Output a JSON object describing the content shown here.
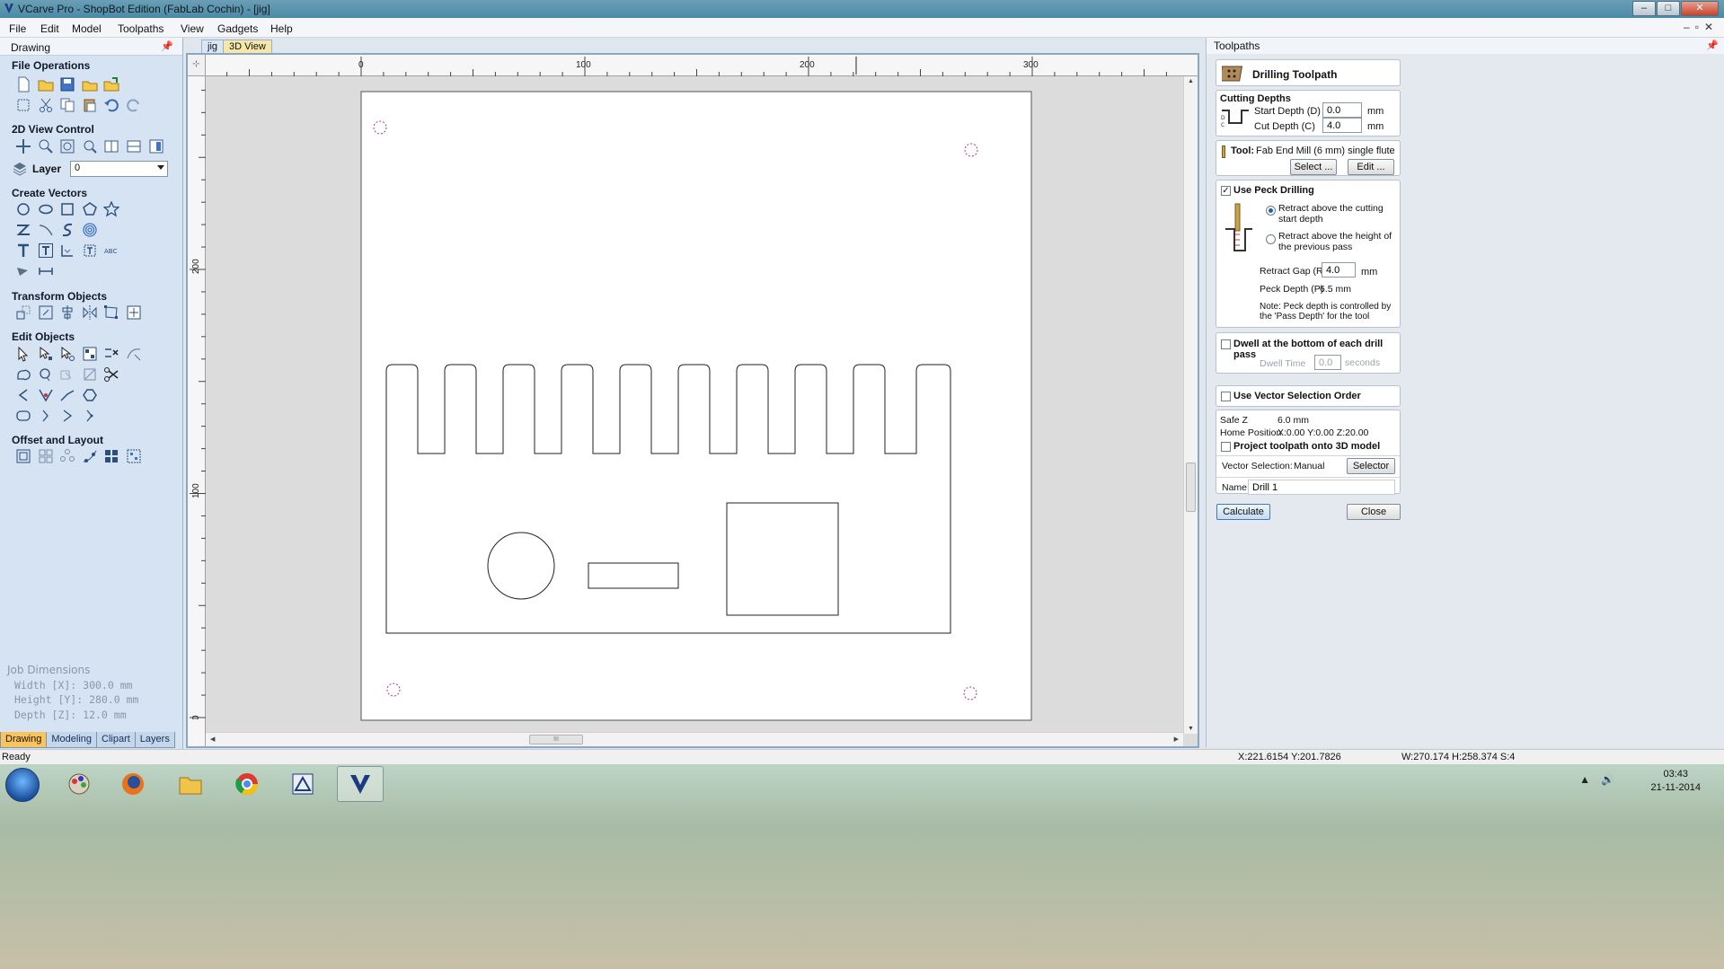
{
  "window": {
    "title": "VCarve Pro - ShopBot Edition (FabLab Cochin) - [jig]"
  },
  "menu": [
    "File",
    "Edit",
    "Model",
    "Toolpaths",
    "View",
    "Gadgets",
    "Help"
  ],
  "left": {
    "panel_title": "Drawing",
    "sections": {
      "file_ops": "File Operations",
      "view2d": "2D View Control",
      "create_vectors": "Create Vectors",
      "transform": "Transform Objects",
      "edit_objects": "Edit Objects",
      "offset_layout": "Offset and Layout"
    },
    "layer_label": "Layer",
    "layer_value": "0",
    "job": {
      "title": "Job Dimensions",
      "width": "Width  [X]: 300.0 mm",
      "height": "Height [Y]: 280.0 mm",
      "depth": "Depth  [Z]: 12.0 mm"
    },
    "tabs": [
      "Drawing",
      "Modeling",
      "Clipart",
      "Layers"
    ]
  },
  "doc": {
    "tabs": [
      "jig",
      "3D View"
    ],
    "ruler_h": [
      "0",
      "100",
      "200",
      "300"
    ],
    "ruler_v": [
      "200",
      "100",
      "0"
    ],
    "hscroll_thumb": "III"
  },
  "toolpaths": {
    "panel_title": "Toolpaths",
    "header": "Drilling Toolpath",
    "cutting_depths": "Cutting Depths",
    "start_depth_label": "Start Depth (D)",
    "start_depth": "0.0",
    "cut_depth_label": "Cut Depth (C)",
    "cut_depth": "4.0",
    "unit": "mm",
    "tool_label": "Tool:",
    "tool_name": "Fab End Mill (6 mm) single flute",
    "select_btn": "Select ...",
    "edit_btn": "Edit ...",
    "peck_label": "Use Peck Drilling",
    "peck_checked": true,
    "retract_opt1": "Retract above the cutting start depth",
    "retract_opt2": "Retract above the height of the previous pass",
    "retract_gap_label": "Retract Gap (R)",
    "retract_gap": "4.0",
    "peck_depth_label": "Peck Depth (P)",
    "peck_depth": "6.5 mm",
    "note": "Note: Peck depth is controlled by the 'Pass Depth' for the tool",
    "dwell_label": "Dwell at the bottom of each drill pass",
    "dwell_time_label": "Dwell Time",
    "dwell_time": "0.0",
    "dwell_unit": "seconds",
    "vector_order_label": "Use Vector Selection Order",
    "safe_z_label": "Safe Z",
    "safe_z": "6.0 mm",
    "home_label": "Home Position",
    "home": "X:0.00 Y:0.00 Z:20.00",
    "project_label": "Project toolpath onto 3D model",
    "vector_sel_label": "Vector Selection:",
    "vector_sel_value": "Manual",
    "selector_btn": "Selector ...",
    "name_label": "Name:",
    "name_value": "Drill 1",
    "calculate_btn": "Calculate",
    "close_btn": "Close"
  },
  "status": {
    "ready": "Ready",
    "coords": "X:221.6154 Y:201.7826",
    "dims": "W:270.174  H:258.374  S:4"
  },
  "taskbar": {
    "time": "03:43",
    "date": "21-11-2014"
  },
  "colors": {
    "accent_tab": "#f7c45e",
    "drill_marker": "#c0307a",
    "left_panel": "#d5e3f3"
  }
}
